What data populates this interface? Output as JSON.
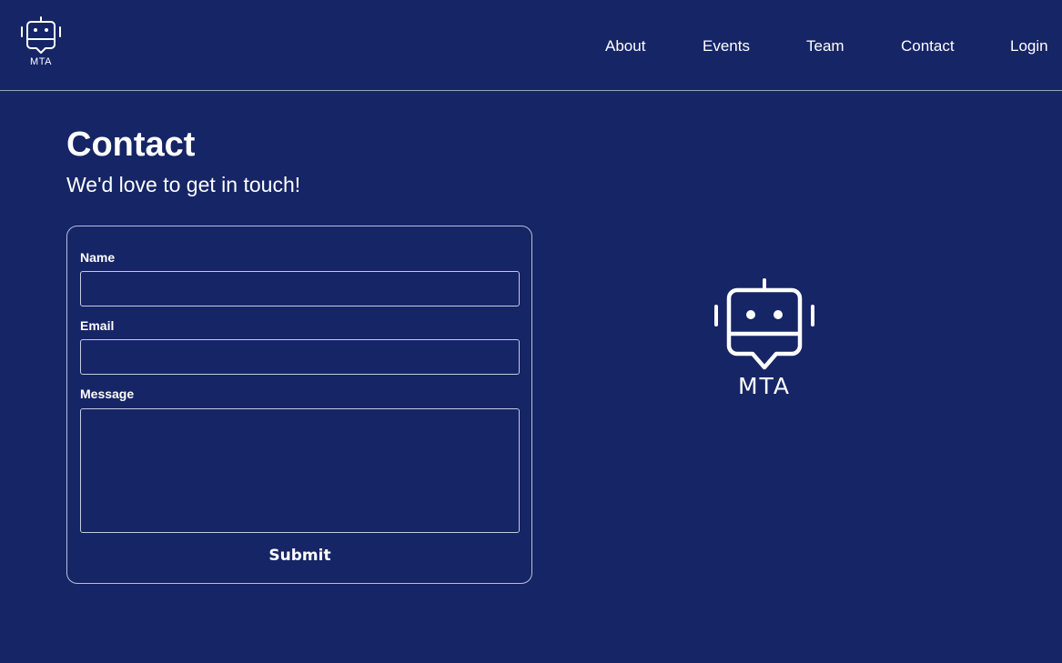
{
  "brand": {
    "logo_text": "MTA",
    "logo_icon": "robot-chat-icon"
  },
  "nav": {
    "items": [
      {
        "label": "About"
      },
      {
        "label": "Events"
      },
      {
        "label": "Team"
      },
      {
        "label": "Contact"
      },
      {
        "label": "Login"
      }
    ]
  },
  "page": {
    "title": "Contact",
    "subtitle": "We'd love to get in touch!"
  },
  "form": {
    "name_label": "Name",
    "name_value": "",
    "email_label": "Email",
    "email_value": "",
    "message_label": "Message",
    "message_value": "",
    "submit_label": "Submit"
  },
  "colors": {
    "background": "#162566",
    "text": "#ffffff",
    "border": "#c5cbe0"
  }
}
